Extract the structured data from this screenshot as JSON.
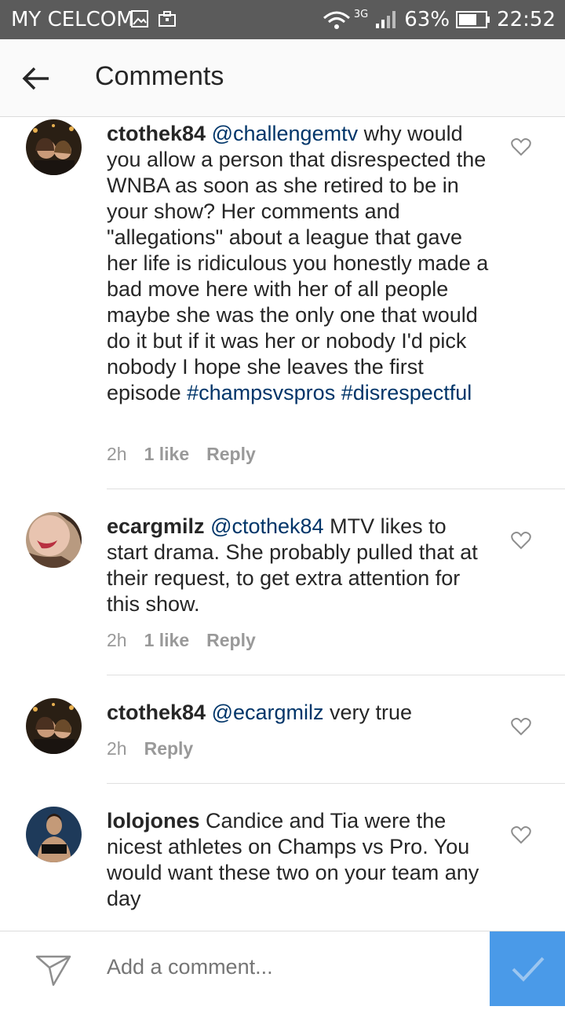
{
  "status_bar": {
    "carrier": "MY CELCOM",
    "network": "3G",
    "battery": "63%",
    "time": "22:52"
  },
  "header": {
    "title": "Comments"
  },
  "comments": [
    {
      "user": "ctothek84",
      "mention": "@challengemtv",
      "body": "why would you allow a person that disrespected the WNBA as soon as she retired to be in your show? Her comments and \"allegations\" about a league that gave her life is ridiculous you honestly made a bad move here with her of all people maybe she was the only one that would do it but if it was her or nobody I'd pick nobody I hope she leaves the first episode",
      "tags": "#champsvspros #disrespectful",
      "time": "2h",
      "likes": "1 like",
      "reply": "Reply"
    },
    {
      "user": "ecargmilz",
      "mention": "@ctothek84",
      "body": "MTV likes to start drama. She probably pulled that at their request, to get extra attention for this show.",
      "time": "2h",
      "likes": "1 like",
      "reply": "Reply"
    },
    {
      "user": "ctothek84",
      "mention": "@ecargmilz",
      "body": "very true",
      "time": "2h",
      "reply": "Reply"
    },
    {
      "user": "lolojones",
      "body": "Candice and Tia were the nicest athletes on Champs vs Pro. You would want these two on your team any day"
    }
  ],
  "composer": {
    "placeholder": "Add a comment..."
  },
  "colors": {
    "accent": "#4a9ae8",
    "link": "#003569",
    "statusbar": "#5b5b5b"
  },
  "icons": {
    "back": "arrow-left-icon",
    "like": "heart-outline-icon",
    "send": "paper-plane-icon",
    "post": "check-icon"
  }
}
